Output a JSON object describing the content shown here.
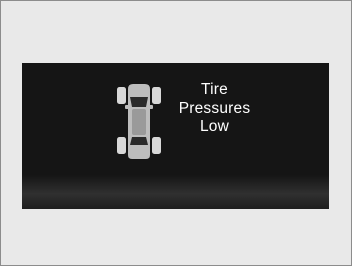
{
  "warning": {
    "icon": "tpms-car-top-view-icon",
    "lines": [
      "Tire",
      "Pressures",
      "Low"
    ]
  },
  "colors": {
    "display_background": "#151515",
    "text": "#ffffff",
    "icon": "#d8d8d8",
    "frame_background": "#e9e9e9"
  }
}
